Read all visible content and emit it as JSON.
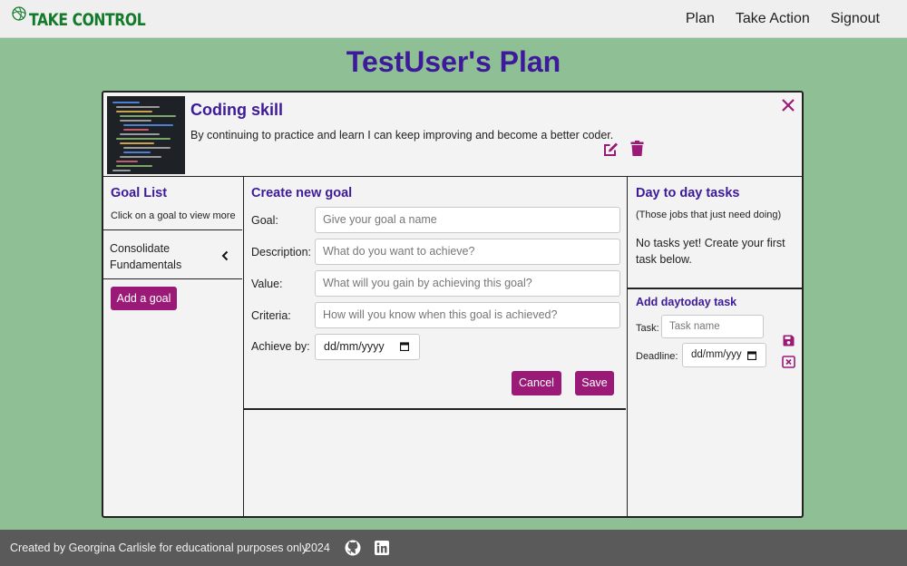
{
  "navbar": {
    "brand": "TAKE CONTROL",
    "links": [
      "Plan",
      "Take Action",
      "Signout"
    ]
  },
  "page_title": "TestUser's Plan",
  "skill": {
    "title": "Coding skill",
    "description": "By continuing to practice and learn I can keep improving and become a better coder."
  },
  "goal_list": {
    "heading": "Goal List",
    "hint": "Click on a goal to view more",
    "items": [
      "Consolidate Fundamentals"
    ],
    "add_button": "Add a goal"
  },
  "goal_form": {
    "heading": "Create new goal",
    "fields": [
      {
        "label": "Goal:",
        "placeholder": "Give your goal a name"
      },
      {
        "label": "Description:",
        "placeholder": "What do you want to achieve?"
      },
      {
        "label": "Value:",
        "placeholder": "What will you gain by achieving this goal?"
      },
      {
        "label": "Criteria:",
        "placeholder": "How will you know when this goal is achieved?"
      }
    ],
    "achieve_by_label": "Achieve by:",
    "achieve_by_value": "dd/mm/yyyy",
    "cancel_button": "Cancel",
    "save_button": "Save"
  },
  "daytoday": {
    "heading": "Day to day tasks",
    "subheading": "(Those jobs that just need doing)",
    "empty_message": "No tasks yet! Create your first task below.",
    "add_heading": "Add daytoday task",
    "task_label": "Task:",
    "task_placeholder": "Task name",
    "deadline_label": "Deadline:",
    "deadline_value": "dd/mm/yyy"
  },
  "footer": {
    "credit": "Created by Georgina Carlisle for educational purposes only",
    "year": "2024"
  },
  "colors": {
    "brand_green": "#137a2a",
    "background": "#8fbf94",
    "title_purple": "#3d1a99",
    "accent_magenta": "#9b1a77",
    "footer_grey": "#5a5a5a"
  },
  "icons": [
    "brand-leaf-icon",
    "edit-icon",
    "trash-icon",
    "close-icon",
    "chevron-left-icon",
    "calendar-icon",
    "save-icon",
    "close-box-icon",
    "github-icon",
    "linkedin-icon"
  ]
}
